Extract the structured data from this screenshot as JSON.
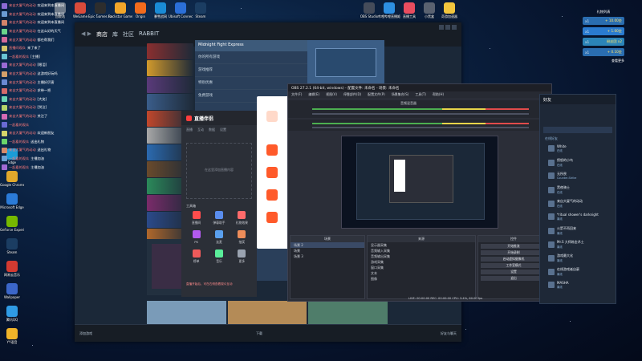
{
  "desktop_icons_top": [
    {
      "label": "回收站",
      "color": "#6f7a89"
    },
    {
      "label": "WeGame",
      "color": "#d94b3b"
    },
    {
      "label": "Epic Games Launcher",
      "color": "#2d2d2d"
    },
    {
      "label": "Rockstar Games...",
      "color": "#f2a62a"
    },
    {
      "label": "Origin",
      "color": "#f26b1d"
    },
    {
      "label": "暴雪战网",
      "color": "#1a8bd6"
    },
    {
      "label": "Ubisoft Connect",
      "color": "#2b6fd8"
    },
    {
      "label": "Steam",
      "color": "#1b3d62"
    }
  ],
  "desktop_icons_right": [
    {
      "label": "OBS Studio",
      "color": "#454c5a"
    },
    {
      "label": "哔哩哔哩直播姬",
      "color": "#2d8fe2"
    },
    {
      "label": "直播工具",
      "color": "#e94d5f"
    },
    {
      "label": "小黑盒",
      "color": "#5a6270"
    },
    {
      "label": "奇游加速器",
      "color": "#f2c53d"
    }
  ],
  "desktop_icons_left": [
    {
      "label": "Edge",
      "color": "#1b9dd8"
    },
    {
      "label": "Google Chrome",
      "color": "#e1a82b"
    },
    {
      "label": "Microsoft Edge",
      "color": "#2b7bd8"
    },
    {
      "label": "GeForce Experience",
      "color": "#76b900"
    },
    {
      "label": "Steam",
      "color": "#1b3d62"
    },
    {
      "label": "网易云音乐",
      "color": "#d33a31"
    },
    {
      "label": "Wallpaper",
      "color": "#3b66c9"
    },
    {
      "label": "腾讯QQ",
      "color": "#2f9be5"
    },
    {
      "label": "YY语音",
      "color": "#f0b429"
    }
  ],
  "chat": [
    {
      "user": "来自大厦气的动动",
      "text": "欢迎来到本直播间",
      "color": "#8c6ad4"
    },
    {
      "user": "来自大厦气的动动",
      "text": "欢迎来到本直播间",
      "color": "#6a9ad4"
    },
    {
      "user": "来自大厦气的动动",
      "text": "欢迎来到本直播间",
      "color": "#d4846a"
    },
    {
      "user": "来自大厦气的动动",
      "text": "在这么好的天气",
      "color": "#6ad48a"
    },
    {
      "user": "来自大厦气的动动",
      "text": "都在帮我们",
      "color": "#d46a9a"
    },
    {
      "user": "直播间观众",
      "text": "来了来了",
      "color": "#d4c46a"
    },
    {
      "user": "一起看的观众",
      "text": "[主播]",
      "color": "#6ac4d4"
    },
    {
      "user": "来自大厦气的动动",
      "text": "[眼泪]",
      "color": "#9a6ad4"
    },
    {
      "user": "来自大厦气的动动",
      "text": "这游戏好玩吗",
      "color": "#d4a06a"
    },
    {
      "user": "来自大厦气的动动",
      "text": "主播好厉害",
      "color": "#6a8ad4"
    },
    {
      "user": "来自大厦气的动动",
      "text": "求带一把",
      "color": "#d46a6a"
    },
    {
      "user": "来自大厦气的动动",
      "text": "[大笑]",
      "color": "#6ad4b4"
    },
    {
      "user": "来自大厦气的动动",
      "text": "[哭泣]",
      "color": "#b4d46a"
    },
    {
      "user": "来自大厦气的动动",
      "text": "关注了",
      "color": "#d46ab4"
    },
    {
      "user": "一起看的观众",
      "text": "",
      "color": "#6a6ad4"
    },
    {
      "user": "来自大厦气的动动",
      "text": "欢迎新朋友",
      "color": "#d4d46a"
    },
    {
      "user": "一起看的观众",
      "text": "送出礼物",
      "color": "#6ad46a"
    },
    {
      "user": "来自大厦气的动动",
      "text": "送出礼物",
      "color": "#d48a6a"
    },
    {
      "user": "一起看的观众",
      "text": "主播加油",
      "color": "#6aa0d4"
    },
    {
      "user": "一起看的观众",
      "text": "主播加油",
      "color": "#a06ad4"
    }
  ],
  "steam": {
    "nav": [
      "商店",
      "库",
      "社区",
      "RABBIT"
    ],
    "featured_title": "Midnight Fight Express",
    "list_items": [
      "你的所有游戏",
      "游戏推荐",
      "特别优惠",
      "免费游戏"
    ],
    "bottom_left": "添加游戏",
    "bottom_center": "下载",
    "bottom_right": "好友与聊天"
  },
  "live_tool": {
    "title": "直播伴侣",
    "tabs": [
      "直播",
      "互动",
      "数据",
      "设置"
    ],
    "placeholder": "在这里添加直播内容",
    "scene_label": "工具箱",
    "tools": [
      {
        "label": "直播间",
        "color": "#ff4d4d"
      },
      {
        "label": "弹幕助手",
        "color": "#5a8dee"
      },
      {
        "label": "礼物效果",
        "color": "#ff6b6b"
      },
      {
        "label": "PK",
        "color": "#b25aee"
      },
      {
        "label": "连麦",
        "color": "#5aa0ee"
      },
      {
        "label": "抽奖",
        "color": "#ee8d5a"
      },
      {
        "label": "榜单",
        "color": "#ee5a5a"
      },
      {
        "label": "音乐",
        "color": "#5aee9a"
      },
      {
        "label": "更多",
        "color": "#9aa3b0"
      }
    ],
    "notice": "直播开始后，可在右侧查看观众互动"
  },
  "obs": {
    "title": "OBS 27.2.1 (64-bit, windows) - 配置文件: 未命名 - 场景: 未命名",
    "menu": [
      "文件(F)",
      "编辑(E)",
      "视图(V)",
      "停靠部件(D)",
      "配置文件(P)",
      "场景集合(S)",
      "工具(T)",
      "帮助(H)"
    ],
    "mixer_label": "音频混音器",
    "docks": {
      "scenes": "场景",
      "sources": "来源",
      "controls": "控件"
    },
    "scenes": [
      "场景 2",
      "场景",
      "场景 3"
    ],
    "sources": [
      "显示器采集",
      "音频输入采集",
      "音频输出采集",
      "游戏采集",
      "窗口采集",
      "文本",
      "图像"
    ],
    "controls": [
      "开始推流",
      "开始录制",
      "启动虚拟摄像机",
      "工作室模式",
      "设置",
      "退出"
    ],
    "status": "LIVE: 00:00:00  REC: 00:00:00  CPU: 3.4%, 60.00 fps"
  },
  "friends": {
    "title": "好友",
    "search_placeholder": "搜索好友",
    "groups": [
      "在线好友",
      "游戏中"
    ],
    "entries": [
      {
        "name": "White",
        "status": "在线"
      },
      {
        "name": "愤怒的小鸟",
        "status": "在线"
      },
      {
        "name": "无所畏",
        "status": "Counter-Strike"
      },
      {
        "name": "黑夜骑士",
        "status": "在线"
      },
      {
        "name": "来自大厦气的动动",
        "status": "在线"
      },
      {
        "name": "*ritual shower's darknight",
        "status": "离线"
      },
      {
        "name": "火箭不再回来",
        "status": "离线"
      },
      {
        "name": "Mr.S 大师炼金术士",
        "status": "离线"
      },
      {
        "name": "游戏最大化",
        "status": "离线"
      },
      {
        "name": "在线游戏者自豪",
        "status": "离线"
      },
      {
        "name": "MASHA",
        "status": "离线"
      }
    ]
  },
  "gift_panel": {
    "header": "礼物列表",
    "rows": [
      {
        "label": "x1",
        "amount": "+ 10.00金",
        "color": "#2a6db0"
      },
      {
        "label": "x1",
        "amount": "+ 1.00金",
        "color": "#2a7bd0"
      },
      {
        "label": "x1",
        "amount": "粉丝团 x2",
        "color": "#2b84b8"
      },
      {
        "label": "x1",
        "amount": "+ 0.10金",
        "color": "#2a6db0"
      }
    ],
    "footer": "查看更多"
  }
}
